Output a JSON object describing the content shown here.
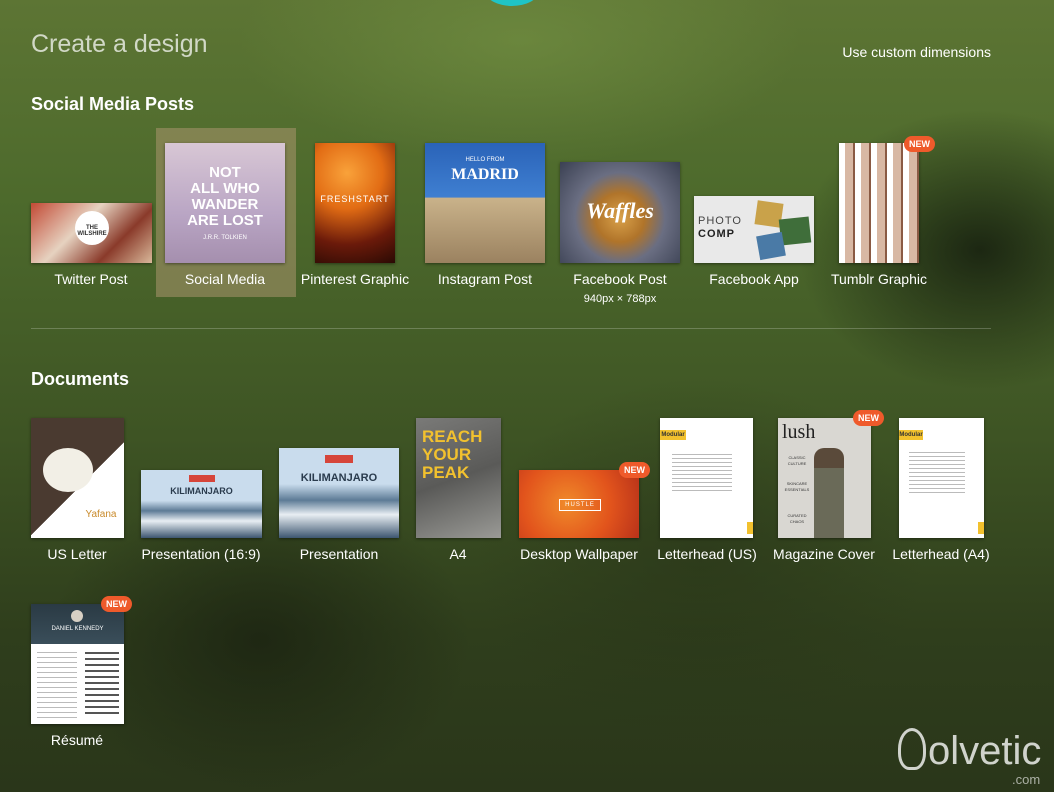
{
  "header": {
    "title": "Create a design",
    "custom_dimensions": "Use custom dimensions"
  },
  "social": {
    "title": "Social Media Posts",
    "items": [
      {
        "label": "Twitter Post"
      },
      {
        "label": "Social Media"
      },
      {
        "label": "Pinterest Graphic"
      },
      {
        "label": "Instagram Post"
      },
      {
        "label": "Facebook Post",
        "dimensions": "940px × 788px"
      },
      {
        "label": "Facebook App"
      },
      {
        "label": "Tumblr Graphic",
        "badge": "NEW"
      }
    ]
  },
  "documents": {
    "title": "Documents",
    "items": [
      {
        "label": "US Letter"
      },
      {
        "label": "Presentation (16:9)"
      },
      {
        "label": "Presentation"
      },
      {
        "label": "A4"
      },
      {
        "label": "Desktop Wallpaper",
        "badge": "NEW"
      },
      {
        "label": "Letterhead (US)"
      },
      {
        "label": "Magazine Cover",
        "badge": "NEW"
      },
      {
        "label": "Letterhead (A4)"
      },
      {
        "label": "Résumé",
        "badge": "NEW"
      }
    ]
  },
  "thumbs": {
    "wilshire": "THE WILSHIRE",
    "wander": [
      "NOT",
      "ALL WHO",
      "WANDER",
      "ARE LOST"
    ],
    "wander_author": "J.R.R. TOLKIEN",
    "freshstart": "FRESHSTART",
    "madrid_small": "HELLO FROM",
    "madrid": "MADRID",
    "waffles": "Waffles",
    "photo": "PHOTO",
    "comp": "COMP",
    "yafana": "Yafana",
    "kilimanjaro": "KILIMANJARO",
    "reach": [
      "REACH",
      "YOUR",
      "PEAK"
    ],
    "hustle": "HUSTLE",
    "modular": "Modular",
    "lush": "lush",
    "lush_lines": [
      "CLASSIC",
      "CULTURE",
      "SKINCARE",
      "ESSENTIALS",
      "CURATED",
      "CHAOS"
    ],
    "resume_name": "DANIEL KENNEDY"
  },
  "brand": {
    "logo": "olvetic",
    "domain": ".com"
  },
  "colors": {
    "badge": "#ef5a2b",
    "accent": "#1fc4c6"
  }
}
